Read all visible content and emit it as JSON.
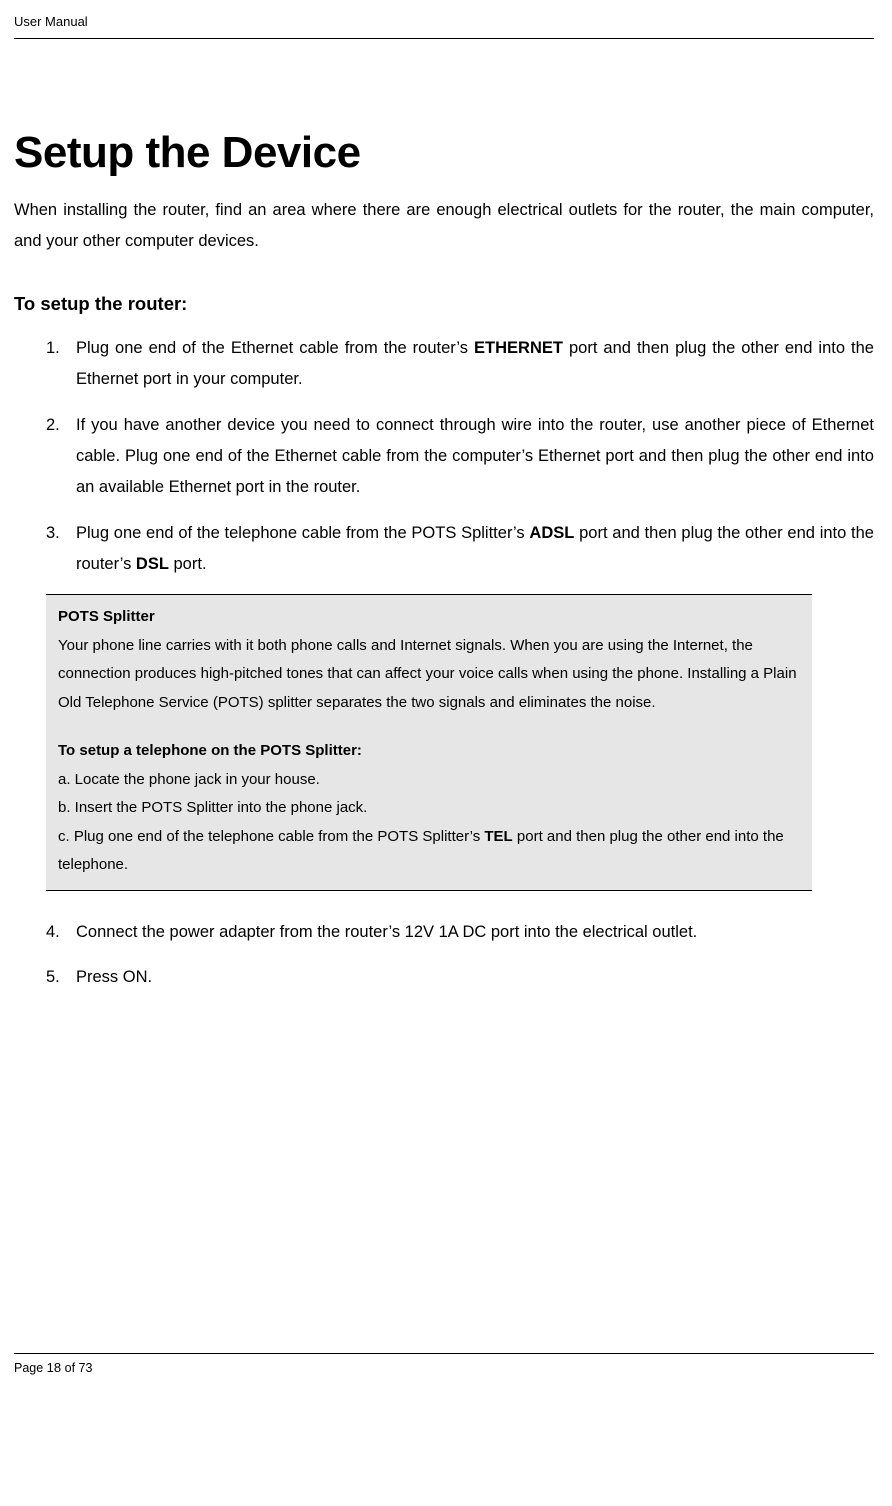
{
  "header": {
    "label": "User Manual"
  },
  "title": "Setup the Device",
  "intro": "When installing the router, find an area where there are enough electrical outlets for the router, the main computer, and your other computer devices.",
  "section_heading": "To setup the router:",
  "steps": [
    {
      "marker": "1.",
      "pre1": "Plug one end of the Ethernet cable from the router’s ",
      "b1": "ETHERNET",
      "post1": " port and then plug the other end into the Ethernet port in your computer."
    },
    {
      "marker": "2.",
      "text": "If you have another device you need to connect through wire into the router, use another piece of Ethernet cable. Plug one end of the Ethernet cable from the computer’s Ethernet port and then plug the other end into an available Ethernet port in the router."
    },
    {
      "marker": "3.",
      "pre1": "Plug one end of the telephone cable from the POTS Splitter’s ",
      "b1": "ADSL",
      "mid1": " port and then plug the other end into the router’s ",
      "b2": "DSL",
      "post1": " port."
    }
  ],
  "infobox": {
    "title": "POTS Splitter",
    "body": "Your phone line carries with it both phone calls and Internet signals. When you are using the Internet, the connection produces high-pitched tones that can affect your voice calls when using the phone. Installing a Plain Old Telephone Service (POTS) splitter separates the two signals and eliminates the noise.",
    "subtitle": "To setup a telephone on the POTS Splitter:",
    "a": "a.  Locate the phone jack in your house.",
    "b": "b. Insert the POTS Splitter into the phone jack.",
    "c_pre": "c. Plug one end of the telephone cable from the POTS Splitter’s ",
    "c_bold": "TEL",
    "c_post": " port and then plug the other end into the telephone."
  },
  "steps2": [
    {
      "marker": "4.",
      "text": "Connect the power adapter from the router’s 12V 1A DC port into the electrical outlet."
    },
    {
      "marker": "5.",
      "text": "Press ON."
    }
  ],
  "footer": {
    "page_prefix": "Page ",
    "current": "18",
    "of_text": " of 73"
  }
}
